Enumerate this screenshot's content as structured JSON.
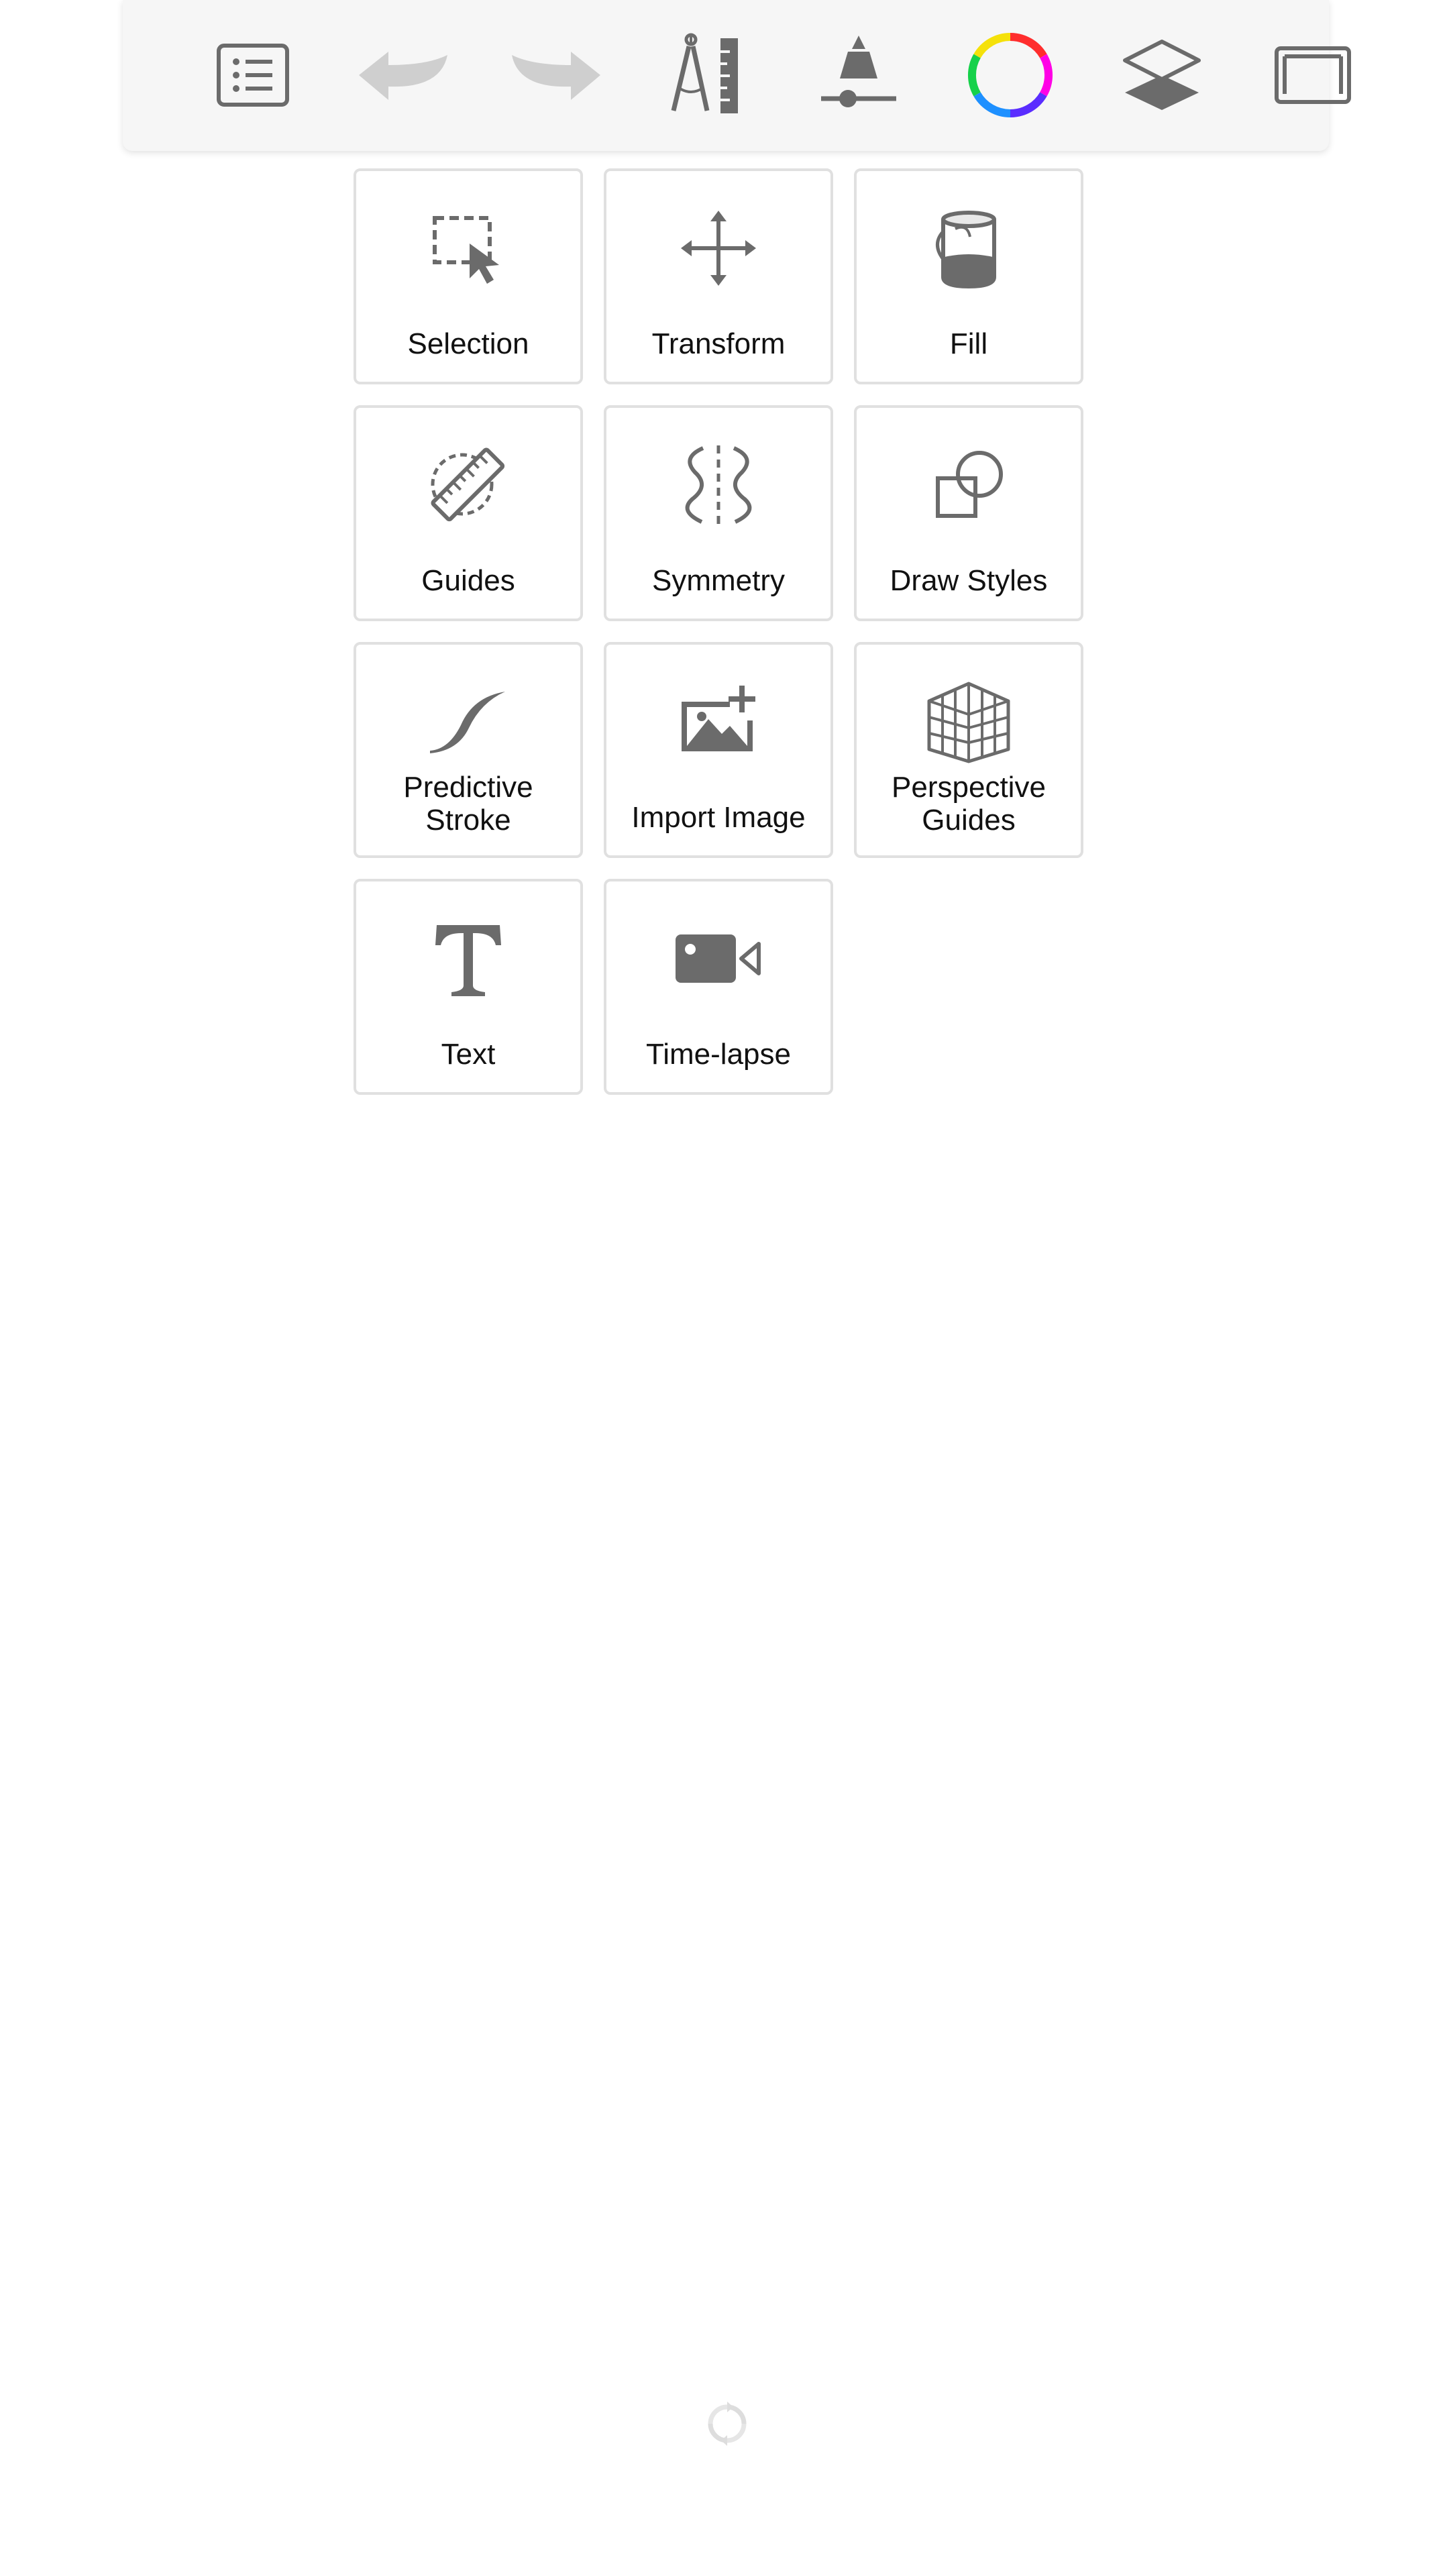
{
  "toolbar": {
    "buttons": [
      {
        "name": "menu",
        "icon": "list-icon"
      },
      {
        "name": "undo",
        "icon": "undo-arrow-icon",
        "state": "disabled"
      },
      {
        "name": "redo",
        "icon": "redo-arrow-icon",
        "state": "disabled"
      },
      {
        "name": "tools",
        "icon": "compass-ruler-icon"
      },
      {
        "name": "brush-properties",
        "icon": "brush-slider-icon"
      },
      {
        "name": "color",
        "icon": "color-wheel-icon"
      },
      {
        "name": "layers",
        "icon": "layers-icon"
      },
      {
        "name": "fullscreen",
        "icon": "canvas-frame-icon"
      }
    ]
  },
  "tools": [
    {
      "label": "Selection",
      "icon": "selection-icon"
    },
    {
      "label": "Transform",
      "icon": "transform-icon"
    },
    {
      "label": "Fill",
      "icon": "fill-bucket-icon"
    },
    {
      "label": "Guides",
      "icon": "ruler-guide-icon"
    },
    {
      "label": "Symmetry",
      "icon": "symmetry-icon"
    },
    {
      "label": "Draw Styles",
      "icon": "shapes-icon"
    },
    {
      "label": "Predictive Stroke",
      "icon": "predictive-stroke-icon"
    },
    {
      "label": "Import Image",
      "icon": "import-image-icon"
    },
    {
      "label": "Perspective Guides",
      "icon": "perspective-grid-icon"
    },
    {
      "label": "Text",
      "icon": "text-icon"
    },
    {
      "label": "Time-lapse",
      "icon": "video-camera-icon"
    }
  ],
  "status": {
    "loading_indicator": "refresh-spinner-icon"
  },
  "colors": {
    "toolbar_bg": "#f6f6f6",
    "icon": "#6b6b6b",
    "icon_disabled": "#cfcfcf",
    "tile_border": "#e0e0e0",
    "label": "#111111"
  }
}
